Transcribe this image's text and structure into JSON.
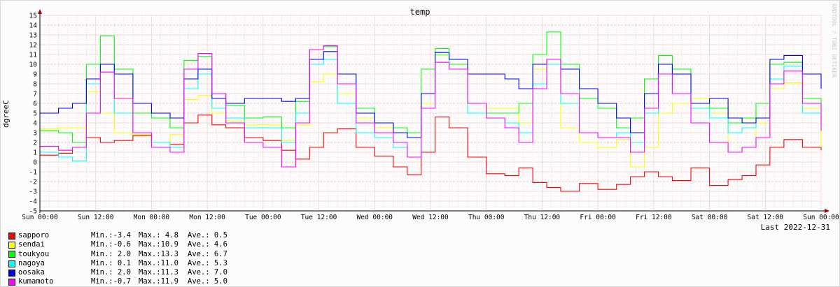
{
  "chart_data": {
    "type": "line",
    "title": "temp",
    "ylabel": "dgreeC",
    "watermark": "RRDTOOL / TOBI OETIKER",
    "footer": "Last 2022-12-31",
    "ylim": [
      -5,
      15
    ],
    "yticks": [
      "15",
      "14",
      "13",
      "12",
      "11",
      "10",
      "9",
      "8",
      "7",
      "6",
      "5",
      "4",
      "3",
      "2",
      "1",
      "0",
      "-1",
      "-2",
      "-3",
      "-4",
      "-5"
    ],
    "xticks": [
      "Sun 00:00",
      "Sun 12:00",
      "Mon 00:00",
      "Mon 12:00",
      "Tue 00:00",
      "Tue 12:00",
      "Wed 00:00",
      "Wed 12:00",
      "Thu 00:00",
      "Thu 12:00",
      "Fri 00:00",
      "Fri 12:00",
      "Sat 00:00",
      "Sat 12:00",
      "Sun 00:00"
    ],
    "x_hours": [
      0,
      4,
      7,
      10,
      13,
      16,
      20,
      24,
      28,
      31,
      34,
      37,
      40,
      44,
      48,
      52,
      55,
      58,
      61,
      64,
      68,
      72,
      76,
      79,
      82,
      85,
      88,
      92,
      96,
      100,
      103,
      106,
      109,
      112,
      116,
      120,
      124,
      127,
      130,
      133,
      136,
      140,
      144,
      148,
      151,
      154,
      157,
      160,
      164,
      168
    ],
    "series": [
      {
        "name": "sapporo",
        "color": "#ff0000",
        "min": "-3.4",
        "max": " 4.8",
        "ave": " 0.5",
        "values": [
          0.7,
          0.9,
          1.5,
          2.5,
          2.0,
          2.2,
          2.7,
          2.0,
          1.8,
          4.0,
          4.8,
          3.8,
          3.5,
          2.5,
          2.2,
          1.2,
          0.3,
          1.5,
          3.0,
          3.4,
          1.5,
          0.6,
          -0.5,
          -1.3,
          1.0,
          4.6,
          3.5,
          0.5,
          -1.2,
          -1.4,
          -0.6,
          -2.1,
          -2.6,
          -3.0,
          -2.2,
          -2.8,
          -2.3,
          -1.5,
          -1.0,
          -1.5,
          -1.9,
          -0.6,
          -2.4,
          -1.8,
          -1.4,
          -0.3,
          1.5,
          2.3,
          1.5,
          1.2
        ]
      },
      {
        "name": "sendai",
        "color": "#ffff00",
        "min": "-0.6",
        "max": "10.9",
        "ave": " 4.6",
        "values": [
          3.4,
          3.5,
          3.5,
          7.2,
          5.0,
          3.0,
          2.8,
          2.0,
          2.8,
          6.4,
          6.8,
          5.0,
          4.2,
          3.8,
          3.8,
          2.2,
          3.8,
          8.2,
          9.0,
          7.0,
          4.5,
          3.5,
          3.0,
          3.0,
          6.0,
          10.9,
          10.0,
          6.0,
          5.5,
          5.5,
          4.0,
          9.5,
          10.5,
          3.5,
          2.0,
          1.5,
          2.3,
          -0.5,
          1.5,
          5.0,
          6.0,
          6.5,
          5.0,
          1.0,
          1.5,
          4.0,
          7.5,
          8.1,
          5.5,
          1.5
        ]
      },
      {
        "name": "toukyou",
        "color": "#00ff00",
        "min": " 2.0",
        "max": "13.3",
        "ave": " 6.7",
        "values": [
          3.2,
          3.0,
          2.0,
          10.0,
          12.9,
          9.5,
          5.0,
          4.5,
          3.5,
          10.4,
          10.8,
          7.0,
          5.8,
          4.5,
          4.6,
          3.5,
          6.2,
          11.5,
          11.8,
          9.0,
          5.5,
          4.0,
          3.5,
          3.0,
          9.5,
          11.6,
          10.0,
          6.0,
          5.0,
          5.0,
          6.0,
          11.0,
          13.3,
          10.0,
          6.5,
          5.5,
          3.5,
          4.5,
          8.5,
          10.9,
          9.5,
          6.0,
          5.5,
          4.0,
          4.5,
          6.0,
          10.0,
          10.2,
          6.5,
          4.0
        ]
      },
      {
        "name": "nagoya",
        "color": "#00ffff",
        "min": " 0.1",
        "max": "11.0",
        "ave": " 5.3",
        "values": [
          1.0,
          0.5,
          0.1,
          8.0,
          10.0,
          5.0,
          3.0,
          2.0,
          1.5,
          7.5,
          9.0,
          5.5,
          4.5,
          3.5,
          3.5,
          2.0,
          5.0,
          10.0,
          10.5,
          6.0,
          3.0,
          2.5,
          1.5,
          0.5,
          7.0,
          11.0,
          9.5,
          5.0,
          4.5,
          4.0,
          3.0,
          8.0,
          10.0,
          6.0,
          3.0,
          2.5,
          3.0,
          2.0,
          5.0,
          9.0,
          7.0,
          5.5,
          4.5,
          3.0,
          3.5,
          4.5,
          8.5,
          9.8,
          5.0,
          3.5
        ]
      },
      {
        "name": "oosaka",
        "color": "#0000ff",
        "min": " 2.0",
        "max": "11.3",
        "ave": " 7.0",
        "values": [
          5.0,
          5.5,
          6.0,
          8.5,
          10.0,
          9.0,
          6.0,
          5.0,
          4.5,
          8.5,
          9.5,
          6.5,
          6.0,
          6.5,
          6.5,
          6.2,
          6.5,
          10.5,
          11.3,
          9.0,
          5.0,
          4.0,
          3.0,
          2.5,
          7.0,
          11.2,
          10.5,
          9.0,
          9.0,
          8.5,
          7.5,
          10.0,
          10.5,
          9.5,
          7.5,
          6.0,
          4.5,
          3.0,
          7.0,
          10.0,
          9.0,
          6.0,
          6.5,
          4.5,
          4.0,
          4.5,
          10.5,
          10.9,
          9.0,
          7.5
        ]
      },
      {
        "name": "kumamoto",
        "color": "#ff00ff",
        "min": "-0.7",
        "max": "11.9",
        "ave": " 5.0",
        "values": [
          1.6,
          1.2,
          1.5,
          5.0,
          9.2,
          6.5,
          3.0,
          1.5,
          1.0,
          9.5,
          11.1,
          7.0,
          4.0,
          2.0,
          1.5,
          -0.5,
          4.0,
          11.5,
          11.9,
          8.0,
          4.0,
          3.0,
          2.0,
          0.5,
          5.5,
          10.2,
          9.5,
          6.0,
          4.5,
          3.5,
          2.0,
          7.5,
          10.5,
          7.0,
          3.0,
          2.5,
          2.5,
          1.0,
          5.5,
          9.0,
          7.0,
          4.0,
          2.0,
          1.0,
          1.5,
          2.5,
          8.0,
          9.3,
          6.0,
          3.2
        ]
      }
    ]
  }
}
